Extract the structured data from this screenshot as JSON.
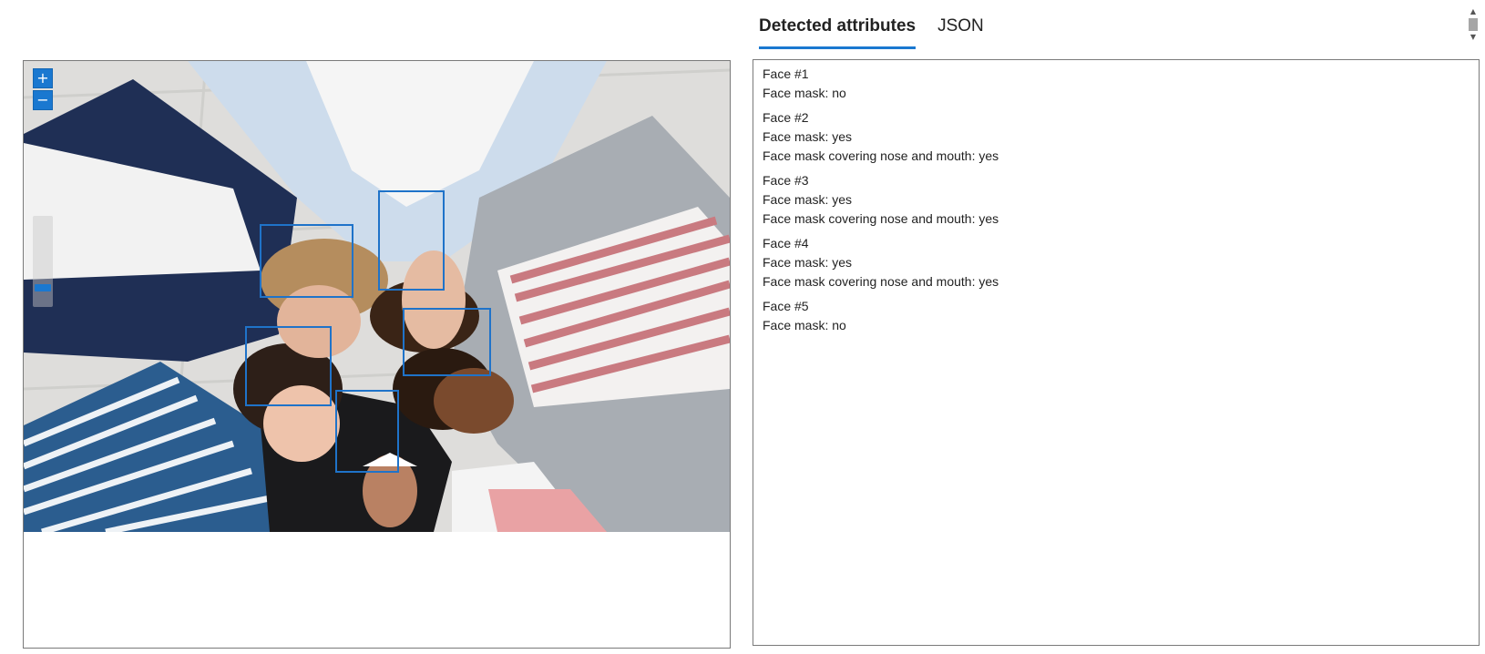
{
  "tabs": [
    {
      "label": "Detected attributes",
      "active": true
    },
    {
      "label": "JSON",
      "active": false
    }
  ],
  "zoom": {
    "zoom_in_icon": "plus-icon",
    "zoom_out_icon": "minus-icon",
    "level": 0.08
  },
  "colors": {
    "accent": "#1a78d0",
    "face_box": "#1f73c9"
  },
  "faces": [
    {
      "title": "Face #1",
      "lines": [
        "Face mask: no"
      ]
    },
    {
      "title": "Face #2",
      "lines": [
        "Face mask: yes",
        "Face mask covering nose and mouth: yes"
      ]
    },
    {
      "title": "Face #3",
      "lines": [
        "Face mask: yes",
        "Face mask covering nose and mouth: yes"
      ]
    },
    {
      "title": "Face #4",
      "lines": [
        "Face mask: yes",
        "Face mask covering nose and mouth: yes"
      ]
    },
    {
      "title": "Face #5",
      "lines": [
        "Face mask: no"
      ]
    }
  ]
}
